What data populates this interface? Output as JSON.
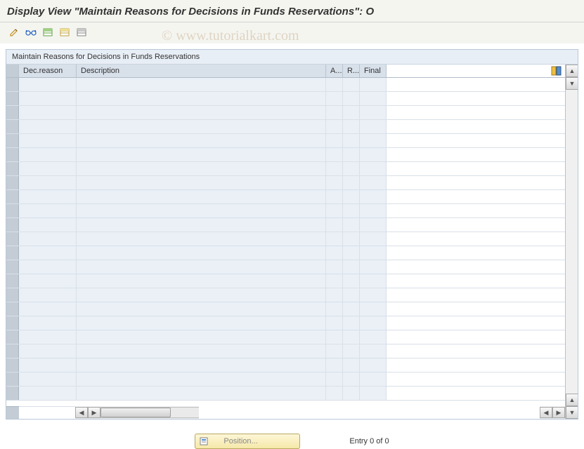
{
  "header": {
    "title": "Display View \"Maintain Reasons for Decisions in Funds Reservations\": O"
  },
  "toolbar": {
    "icons": [
      "change-icon",
      "glasses-icon",
      "table-green-icon",
      "table-yellow-icon",
      "table-grey-icon"
    ]
  },
  "watermark": "© www.tutorialkart.com",
  "panel": {
    "title": "Maintain Reasons for Decisions in Funds Reservations"
  },
  "table": {
    "columns": {
      "dec_reason": "Dec.reason",
      "description": "Description",
      "a": "A...",
      "r": "R...",
      "final": "Final"
    },
    "row_count": 23
  },
  "footer": {
    "position_label": "Position...",
    "entry_text": "Entry 0 of 0"
  }
}
